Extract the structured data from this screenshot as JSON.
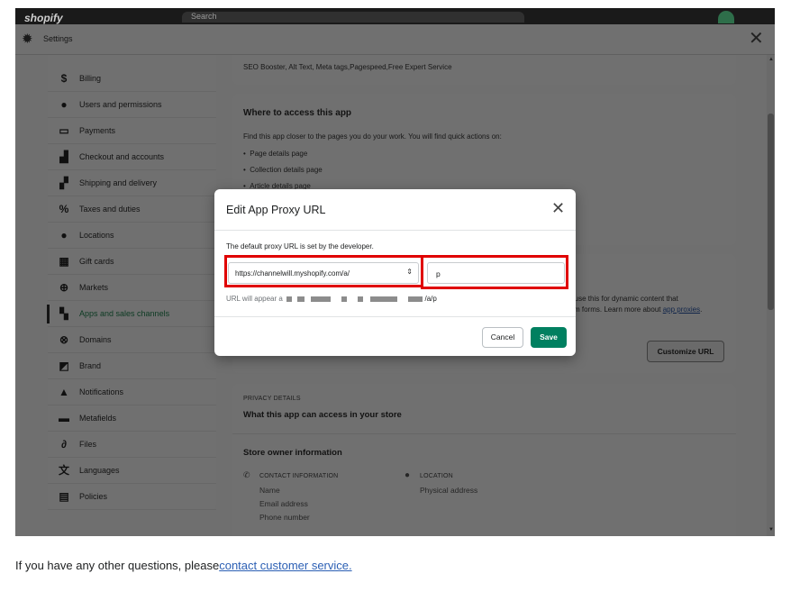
{
  "topbar": {
    "logo": "shopify",
    "search_placeholder": "Search"
  },
  "window": {
    "title": "Settings"
  },
  "sidebar": {
    "items": [
      {
        "label": "Billing",
        "icon": "billing-icon",
        "glyph": "$"
      },
      {
        "label": "Users and permissions",
        "icon": "user-icon",
        "glyph": "●"
      },
      {
        "label": "Payments",
        "icon": "payments-icon",
        "glyph": "▭"
      },
      {
        "label": "Checkout and accounts",
        "icon": "cart-icon",
        "glyph": "▟"
      },
      {
        "label": "Shipping and delivery",
        "icon": "truck-icon",
        "glyph": "▞"
      },
      {
        "label": "Taxes and duties",
        "icon": "taxes-icon",
        "glyph": "%"
      },
      {
        "label": "Locations",
        "icon": "location-pin-icon",
        "glyph": "●"
      },
      {
        "label": "Gift cards",
        "icon": "gift-icon",
        "glyph": "▦"
      },
      {
        "label": "Markets",
        "icon": "globe-icon",
        "glyph": "⊕"
      },
      {
        "label": "Apps and sales channels",
        "icon": "apps-icon",
        "glyph": "▚",
        "active": true
      },
      {
        "label": "Domains",
        "icon": "domains-icon",
        "glyph": "⊗"
      },
      {
        "label": "Brand",
        "icon": "brand-icon",
        "glyph": "◩"
      },
      {
        "label": "Notifications",
        "icon": "bell-icon",
        "glyph": "▲"
      },
      {
        "label": "Metafields",
        "icon": "metafields-icon",
        "glyph": "▬"
      },
      {
        "label": "Files",
        "icon": "paperclip-icon",
        "glyph": "∂"
      },
      {
        "label": "Languages",
        "icon": "language-icon",
        "glyph": "文"
      },
      {
        "label": "Policies",
        "icon": "policies-icon",
        "glyph": "▤"
      }
    ]
  },
  "main": {
    "app_tagline": "SEO Booster, Alt Text, Meta tags,Pagespeed,Free Expert Service",
    "access": {
      "title": "Where to access this app",
      "description": "Find this app closer to the pages you do your work. You will find quick actions on:",
      "bullets": [
        "Page details page",
        "Collection details page",
        "Article details page"
      ]
    },
    "proxy": {
      "text_line1": "n use this for dynamic content that",
      "text_line2": "m forms. Learn more about",
      "link": "app proxies",
      "link_suffix": ".",
      "customize_button": "Customize URL"
    },
    "privacy": {
      "eyebrow": "PRIVACY DETAILS",
      "title": "What this app can access in your store",
      "owner_title": "Store owner information",
      "contact_heading": "CONTACT INFORMATION",
      "contact_items": [
        "Name",
        "Email address",
        "Phone number"
      ],
      "location_heading": "LOCATION",
      "location_items": [
        "Physical address"
      ]
    }
  },
  "modal": {
    "title": "Edit App Proxy URL",
    "description": "The default proxy URL is set by the developer.",
    "select_value": "https://channelwill.myshopify.com/a/",
    "input_value": "p",
    "appear_prefix": "URL will appear a",
    "appear_suffix": "/a/p",
    "cancel": "Cancel",
    "save": "Save"
  },
  "footer": {
    "prefix": "If you have any other questions, please",
    "link": "contact customer service."
  },
  "colors": {
    "save_green": "#008060",
    "highlight_red": "#e00000",
    "link_blue": "#2b5fb4"
  }
}
